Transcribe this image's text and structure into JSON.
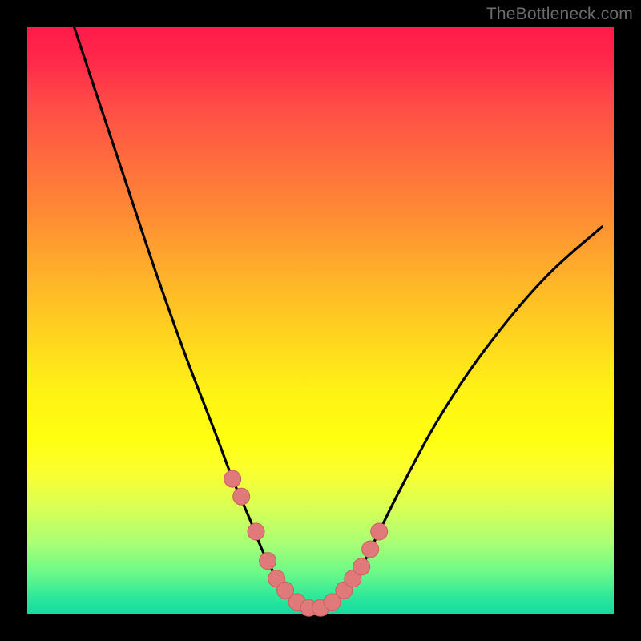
{
  "watermark": "TheBottleneck.com",
  "colors": {
    "frame": "#000000",
    "curve": "#000000",
    "marker_fill": "#e07a7a",
    "marker_stroke": "#c96060"
  },
  "chart_data": {
    "type": "line",
    "title": "",
    "xlabel": "",
    "ylabel": "",
    "xlim": [
      0,
      100
    ],
    "ylim": [
      0,
      100
    ],
    "series": [
      {
        "name": "bottleneck-curve",
        "x": [
          8,
          12,
          17,
          22,
          27,
          32,
          35,
          38,
          40,
          42,
          44,
          46,
          48,
          50,
          52,
          54,
          57,
          60,
          64,
          70,
          78,
          88,
          98
        ],
        "y": [
          100,
          88,
          73,
          58,
          44,
          31,
          23,
          16,
          11,
          7,
          4,
          2,
          1,
          1,
          2,
          4,
          8,
          14,
          22,
          33,
          45,
          57,
          66
        ]
      }
    ],
    "markers": {
      "name": "highlight-points",
      "x": [
        35,
        36.5,
        39,
        41,
        42.5,
        44,
        46,
        48,
        50,
        52,
        54,
        55.5,
        57,
        58.5,
        60
      ],
      "y": [
        23,
        20,
        14,
        9,
        6,
        4,
        2,
        1,
        1,
        2,
        4,
        6,
        8,
        11,
        14
      ]
    }
  }
}
